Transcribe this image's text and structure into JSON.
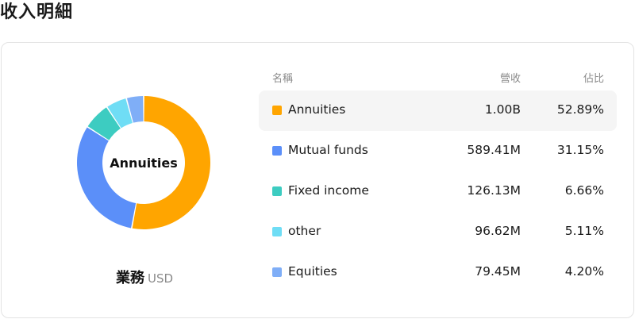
{
  "header": {
    "title": "收入明細"
  },
  "segment": {
    "name": "業務",
    "unit": "USD"
  },
  "donut": {
    "center_label": "Annuities"
  },
  "table": {
    "columns": {
      "name": "名稱",
      "revenue": "營收",
      "share": "佔比"
    },
    "rows": [
      {
        "name": "Annuities",
        "revenue": "1.00B",
        "share": "52.89%",
        "color": "#FFA500"
      },
      {
        "name": "Mutual funds",
        "revenue": "589.41M",
        "share": "31.15%",
        "color": "#5B8FF9"
      },
      {
        "name": "Fixed income",
        "revenue": "126.13M",
        "share": "6.66%",
        "color": "#3DCCC1"
      },
      {
        "name": "other",
        "revenue": "96.62M",
        "share": "5.11%",
        "color": "#6FDDF5"
      },
      {
        "name": "Equities",
        "revenue": "79.45M",
        "share": "4.20%",
        "color": "#7FAEF7"
      }
    ]
  },
  "chart_data": {
    "type": "pie",
    "categories": [
      "Annuities",
      "Mutual funds",
      "Fixed income",
      "other",
      "Equities"
    ],
    "values": [
      52.89,
      31.15,
      6.66,
      5.11,
      4.2
    ],
    "colors": [
      "#FFA500",
      "#5B8FF9",
      "#3DCCC1",
      "#6FDDF5",
      "#7FAEF7"
    ]
  }
}
